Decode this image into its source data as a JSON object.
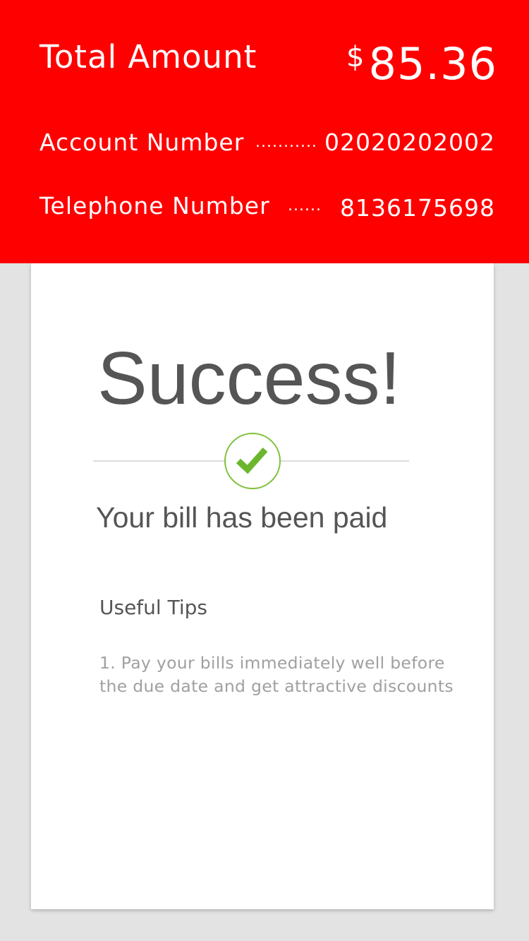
{
  "header": {
    "total_label": "Total Amount",
    "currency_symbol": "$",
    "total_amount": "85.36",
    "account_label": "Account Number",
    "account_dots": "...........",
    "account_value": "02020202002",
    "telephone_label": "Telephone Number",
    "telephone_dots": "......",
    "telephone_value": "8136175698",
    "background_color": "#ff0000"
  },
  "card": {
    "title": "Success!",
    "status_icon": "checkmark-circle-icon",
    "message": "Your bill has been paid",
    "tips_heading": "Useful Tips",
    "tips_text": "1. Pay your bills immediately well before the due date and get attractive discounts",
    "accent_color": "#7dc13a"
  }
}
